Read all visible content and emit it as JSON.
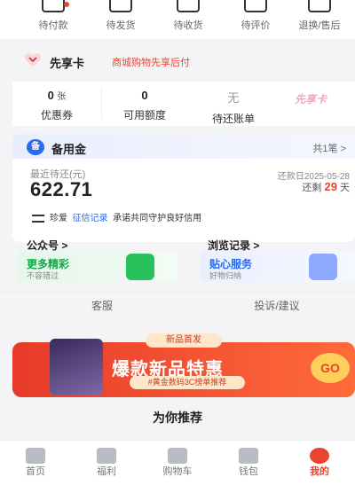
{
  "orders": [
    {
      "label": "待付款",
      "icon": "wallet-icon"
    },
    {
      "label": "待发货",
      "icon": "box-icon"
    },
    {
      "label": "待收货",
      "icon": "truck-icon"
    },
    {
      "label": "待评价",
      "icon": "comment-icon"
    },
    {
      "label": "退换/售后",
      "icon": "return-icon"
    }
  ],
  "prebanner": {
    "title": "先享卡",
    "subtitle": "商城购物先享后付"
  },
  "stats": [
    {
      "value": "0",
      "unit": "张",
      "label": "优惠券"
    },
    {
      "value": "0",
      "unit": "",
      "label": "可用额度"
    },
    {
      "value": "无",
      "unit": "",
      "label": "待还账单"
    }
  ],
  "stats_logo": "先享卡",
  "fund": {
    "title": "备用金",
    "count": "共1笔 >",
    "recent_label": "最近待还(元)",
    "amount": "622.71",
    "due_date": "还款日2025-05-28",
    "remaining_prefix": "还剩",
    "remaining_days": "29",
    "remaining_suffix": "天",
    "note_brand": "珍爱",
    "note_link": "征信记录",
    "note_text": "承诺共同守护良好信用"
  },
  "shortcuts": [
    {
      "title": "公众号 >",
      "card_title": "更多精彩",
      "card_sub": "不容错过",
      "accent": "#12a84a"
    },
    {
      "title": "浏览记录 >",
      "card_title": "贴心服务",
      "card_sub": "好物归纳",
      "accent": "#2a6bf0"
    }
  ],
  "services": [
    "客服",
    "投诉/建议"
  ],
  "promo": {
    "tag": "新品首发",
    "title": "爆款新品特惠",
    "subtitle": "#黄金数码3C榜单推荐",
    "go": "GO"
  },
  "recommend_title": "为你推荐",
  "tabs": [
    {
      "label": "首页",
      "icon": "home-icon",
      "active": false
    },
    {
      "label": "福利",
      "icon": "star-icon",
      "active": false
    },
    {
      "label": "购物车",
      "icon": "cart-icon",
      "active": false
    },
    {
      "label": "钱包",
      "icon": "wallet-icon",
      "active": false
    },
    {
      "label": "我的",
      "icon": "user-icon",
      "active": true
    }
  ],
  "colors": {
    "accent": "#e8442f",
    "link": "#2a6bf0",
    "green": "#12a84a"
  }
}
